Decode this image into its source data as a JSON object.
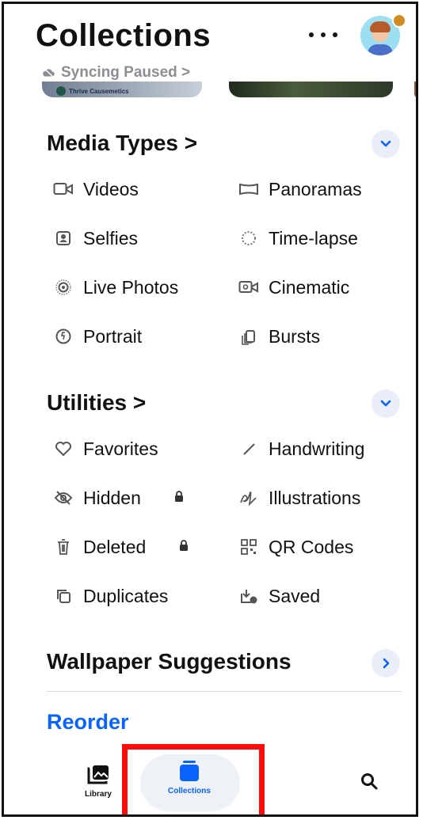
{
  "header": {
    "title": "Collections",
    "sync_status": "Syncing Paused >",
    "thumbnail_caption": "Thrive Causemetics",
    "icons": [
      "more-icon",
      "avatar-icon",
      "cloud-slash-icon"
    ]
  },
  "media_types": {
    "title": "Media Types >",
    "items": [
      {
        "label": "Videos",
        "icon": "video-icon"
      },
      {
        "label": "Panoramas",
        "icon": "panorama-icon"
      },
      {
        "label": "Selfies",
        "icon": "selfie-icon"
      },
      {
        "label": "Time-lapse",
        "icon": "timelapse-icon"
      },
      {
        "label": "Live Photos",
        "icon": "live-photo-icon"
      },
      {
        "label": "Cinematic",
        "icon": "cinematic-icon"
      },
      {
        "label": "Portrait",
        "icon": "portrait-icon"
      },
      {
        "label": "Bursts",
        "icon": "bursts-icon"
      }
    ]
  },
  "utilities": {
    "title": "Utilities >",
    "items": [
      {
        "label": "Favorites",
        "icon": "heart-icon"
      },
      {
        "label": "Handwriting",
        "icon": "pencil-icon"
      },
      {
        "label": "Hidden",
        "icon": "eye-slash-icon",
        "locked": true
      },
      {
        "label": "Illustrations",
        "icon": "illustration-icon"
      },
      {
        "label": "Deleted",
        "icon": "trash-icon",
        "locked": true
      },
      {
        "label": "QR Codes",
        "icon": "qr-code-icon"
      },
      {
        "label": "Duplicates",
        "icon": "duplicate-icon"
      },
      {
        "label": "Saved",
        "icon": "saved-icon"
      }
    ]
  },
  "wallpaper": {
    "title": "Wallpaper Suggestions"
  },
  "reorder_label": "Reorder",
  "tabbar": {
    "library": "Library",
    "collections": "Collections",
    "search_icon": "search-icon"
  },
  "colors": {
    "accent": "#0a63ff",
    "highlight": "#ff0b0b"
  }
}
